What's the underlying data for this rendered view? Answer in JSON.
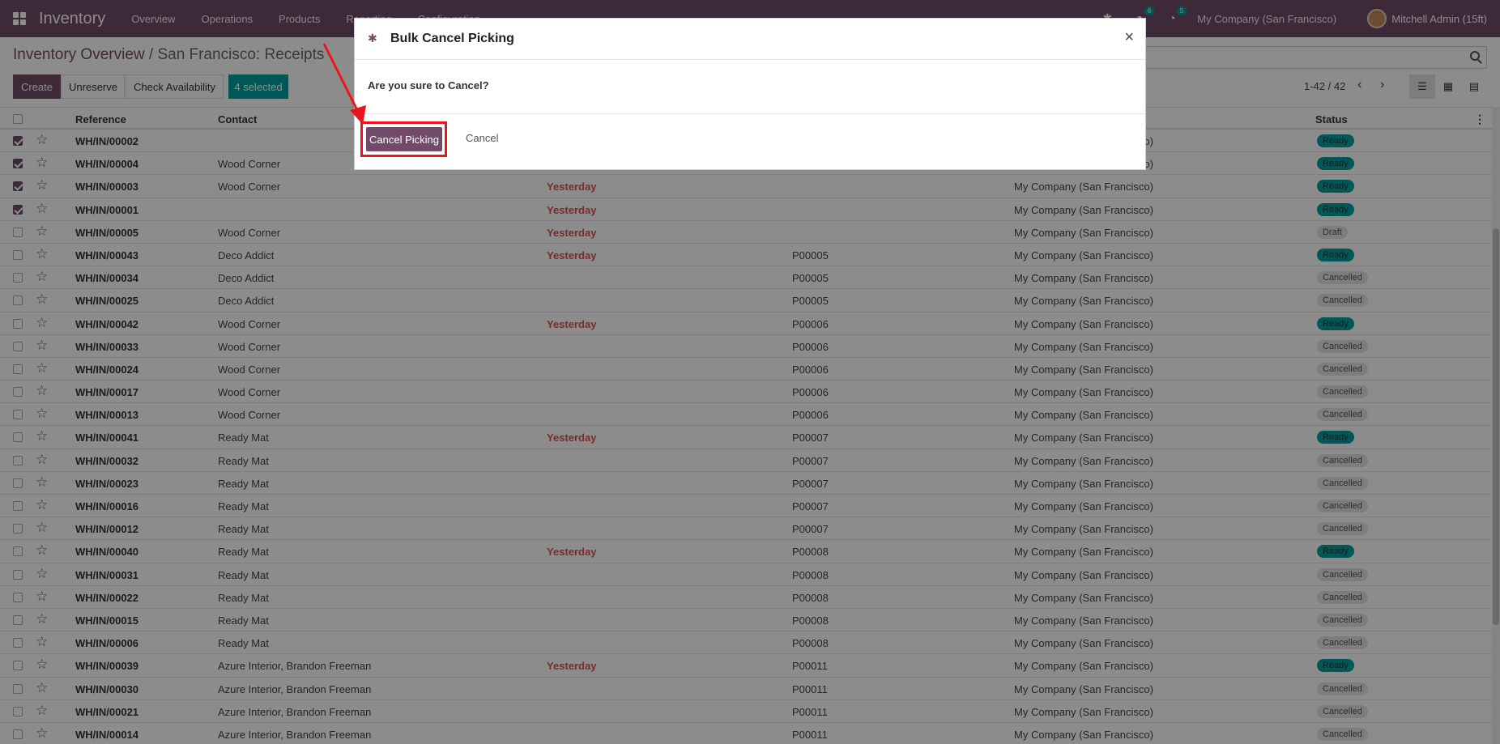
{
  "navbar": {
    "brand": "Inventory",
    "menu": [
      "Overview",
      "Operations",
      "Products",
      "Reporting",
      "Configuration"
    ],
    "chat_badge": "6",
    "activity_badge": "5",
    "company": "My Company (San Francisco)",
    "user": "Mitchell Admin (15ft)"
  },
  "breadcrumb": {
    "parent": "Inventory Overview",
    "separator": "/",
    "current": "San Francisco: Receipts"
  },
  "toolbar": {
    "create": "Create",
    "unreserve": "Unreserve",
    "check": "Check Availability",
    "selected": "4 selected"
  },
  "pager": {
    "text": "1-42 / 42"
  },
  "table": {
    "headers": {
      "reference": "Reference",
      "contact": "Contact",
      "status": "Status"
    },
    "rows": [
      {
        "checked": true,
        "ref": "WH/IN/00002",
        "contact": "",
        "date": "",
        "source": "",
        "company": "My Company (San Francisco)",
        "status": "Ready"
      },
      {
        "checked": true,
        "ref": "WH/IN/00004",
        "contact": "Wood Corner",
        "date": "",
        "source": "",
        "company": "My Company (San Francisco)",
        "status": "Ready"
      },
      {
        "checked": true,
        "ref": "WH/IN/00003",
        "contact": "Wood Corner",
        "date": "Yesterday",
        "source": "",
        "company": "My Company (San Francisco)",
        "status": "Ready"
      },
      {
        "checked": true,
        "ref": "WH/IN/00001",
        "contact": "",
        "date": "Yesterday",
        "source": "",
        "company": "My Company (San Francisco)",
        "status": "Ready"
      },
      {
        "checked": false,
        "ref": "WH/IN/00005",
        "contact": "Wood Corner",
        "date": "Yesterday",
        "source": "",
        "company": "My Company (San Francisco)",
        "status": "Draft"
      },
      {
        "checked": false,
        "ref": "WH/IN/00043",
        "contact": "Deco Addict",
        "date": "Yesterday",
        "source": "P00005",
        "company": "My Company (San Francisco)",
        "status": "Ready"
      },
      {
        "checked": false,
        "ref": "WH/IN/00034",
        "contact": "Deco Addict",
        "date": "",
        "source": "P00005",
        "company": "My Company (San Francisco)",
        "status": "Cancelled"
      },
      {
        "checked": false,
        "ref": "WH/IN/00025",
        "contact": "Deco Addict",
        "date": "",
        "source": "P00005",
        "company": "My Company (San Francisco)",
        "status": "Cancelled"
      },
      {
        "checked": false,
        "ref": "WH/IN/00042",
        "contact": "Wood Corner",
        "date": "Yesterday",
        "source": "P00006",
        "company": "My Company (San Francisco)",
        "status": "Ready"
      },
      {
        "checked": false,
        "ref": "WH/IN/00033",
        "contact": "Wood Corner",
        "date": "",
        "source": "P00006",
        "company": "My Company (San Francisco)",
        "status": "Cancelled"
      },
      {
        "checked": false,
        "ref": "WH/IN/00024",
        "contact": "Wood Corner",
        "date": "",
        "source": "P00006",
        "company": "My Company (San Francisco)",
        "status": "Cancelled"
      },
      {
        "checked": false,
        "ref": "WH/IN/00017",
        "contact": "Wood Corner",
        "date": "",
        "source": "P00006",
        "company": "My Company (San Francisco)",
        "status": "Cancelled"
      },
      {
        "checked": false,
        "ref": "WH/IN/00013",
        "contact": "Wood Corner",
        "date": "",
        "source": "P00006",
        "company": "My Company (San Francisco)",
        "status": "Cancelled"
      },
      {
        "checked": false,
        "ref": "WH/IN/00041",
        "contact": "Ready Mat",
        "date": "Yesterday",
        "source": "P00007",
        "company": "My Company (San Francisco)",
        "status": "Ready"
      },
      {
        "checked": false,
        "ref": "WH/IN/00032",
        "contact": "Ready Mat",
        "date": "",
        "source": "P00007",
        "company": "My Company (San Francisco)",
        "status": "Cancelled"
      },
      {
        "checked": false,
        "ref": "WH/IN/00023",
        "contact": "Ready Mat",
        "date": "",
        "source": "P00007",
        "company": "My Company (San Francisco)",
        "status": "Cancelled"
      },
      {
        "checked": false,
        "ref": "WH/IN/00016",
        "contact": "Ready Mat",
        "date": "",
        "source": "P00007",
        "company": "My Company (San Francisco)",
        "status": "Cancelled"
      },
      {
        "checked": false,
        "ref": "WH/IN/00012",
        "contact": "Ready Mat",
        "date": "",
        "source": "P00007",
        "company": "My Company (San Francisco)",
        "status": "Cancelled"
      },
      {
        "checked": false,
        "ref": "WH/IN/00040",
        "contact": "Ready Mat",
        "date": "Yesterday",
        "source": "P00008",
        "company": "My Company (San Francisco)",
        "status": "Ready"
      },
      {
        "checked": false,
        "ref": "WH/IN/00031",
        "contact": "Ready Mat",
        "date": "",
        "source": "P00008",
        "company": "My Company (San Francisco)",
        "status": "Cancelled"
      },
      {
        "checked": false,
        "ref": "WH/IN/00022",
        "contact": "Ready Mat",
        "date": "",
        "source": "P00008",
        "company": "My Company (San Francisco)",
        "status": "Cancelled"
      },
      {
        "checked": false,
        "ref": "WH/IN/00015",
        "contact": "Ready Mat",
        "date": "",
        "source": "P00008",
        "company": "My Company (San Francisco)",
        "status": "Cancelled"
      },
      {
        "checked": false,
        "ref": "WH/IN/00006",
        "contact": "Ready Mat",
        "date": "",
        "source": "P00008",
        "company": "My Company (San Francisco)",
        "status": "Cancelled"
      },
      {
        "checked": false,
        "ref": "WH/IN/00039",
        "contact": "Azure Interior, Brandon Freeman",
        "date": "Yesterday",
        "source": "P00011",
        "company": "My Company (San Francisco)",
        "status": "Ready"
      },
      {
        "checked": false,
        "ref": "WH/IN/00030",
        "contact": "Azure Interior, Brandon Freeman",
        "date": "",
        "source": "P00011",
        "company": "My Company (San Francisco)",
        "status": "Cancelled"
      },
      {
        "checked": false,
        "ref": "WH/IN/00021",
        "contact": "Azure Interior, Brandon Freeman",
        "date": "",
        "source": "P00011",
        "company": "My Company (San Francisco)",
        "status": "Cancelled"
      },
      {
        "checked": false,
        "ref": "WH/IN/00014",
        "contact": "Azure Interior, Brandon Freeman",
        "date": "",
        "source": "P00011",
        "company": "My Company (San Francisco)",
        "status": "Cancelled"
      }
    ]
  },
  "modal": {
    "title": "Bulk Cancel Picking",
    "close": "×",
    "question": "Are you sure to Cancel?",
    "confirm": "Cancel Picking",
    "cancel": "Cancel"
  },
  "colors": {
    "brand": "#714b67",
    "teal": "#00a09d",
    "highlight": "#e8161c"
  }
}
